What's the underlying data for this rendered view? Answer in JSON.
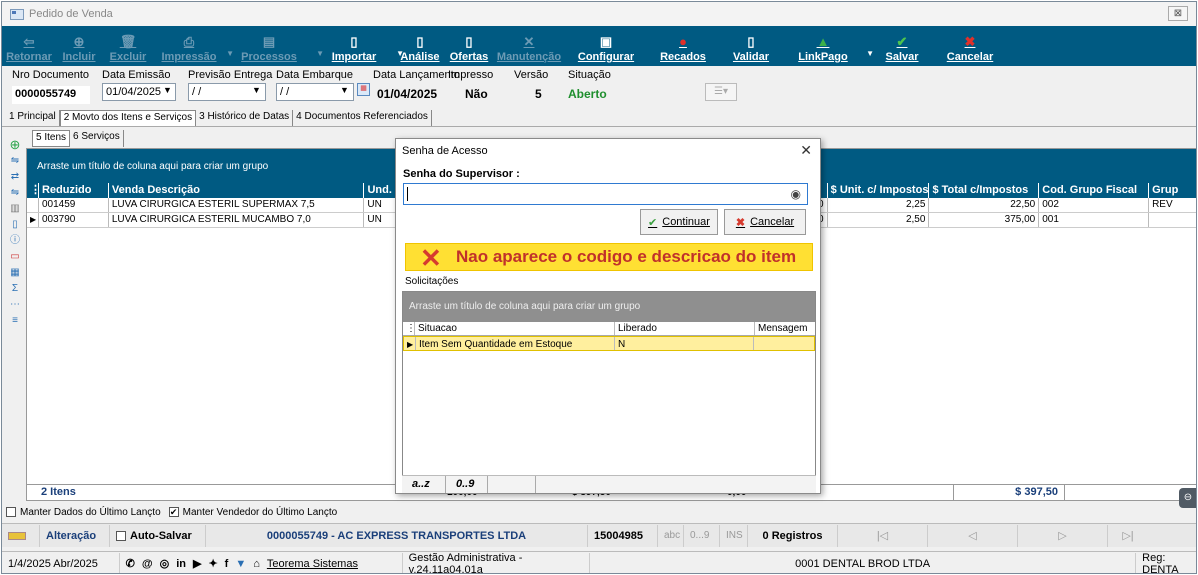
{
  "window": {
    "title": "Pedido de Venda",
    "close_label": "⊠"
  },
  "toolbar": {
    "buttons": [
      {
        "label": "Retornar",
        "icon": "⇦",
        "enabled": false
      },
      {
        "label": "Incluir",
        "icon": "⊕",
        "enabled": false
      },
      {
        "label": "Excluir",
        "icon": "🗑",
        "enabled": false
      },
      {
        "label": "Impressão",
        "icon": "⎙",
        "enabled": false
      },
      {
        "label": "Processos",
        "icon": "▤",
        "enabled": false
      },
      {
        "label": "Importar",
        "icon": "▯",
        "enabled": true
      },
      {
        "label": "Análise",
        "icon": "▯",
        "enabled": true
      },
      {
        "label": "Ofertas",
        "icon": "▯",
        "enabled": true
      },
      {
        "label": "Manutenção",
        "icon": "✕",
        "enabled": false
      },
      {
        "label": "Configurar",
        "icon": "▣",
        "enabled": true
      },
      {
        "label": "Recados",
        "icon": "●",
        "enabled": true
      },
      {
        "label": "Validar",
        "icon": "▯",
        "enabled": true
      },
      {
        "label": "LinkPago",
        "icon": "▲",
        "enabled": true
      },
      {
        "label": "Salvar",
        "icon": "✔",
        "enabled": true
      },
      {
        "label": "Cancelar",
        "icon": "✖",
        "enabled": true
      }
    ]
  },
  "form": {
    "nro_documento_label": "Nro Documento",
    "nro_documento": "0000055749",
    "data_emissao_label": "Data Emissão",
    "data_emissao": "01/04/2025",
    "previsao_entrega_label": "Previsão Entrega",
    "previsao_entrega": "/ /",
    "data_embarque_label": "Data Embarque",
    "data_embarque": "/ /",
    "data_lancamento_label": "Data Lançamento",
    "data_lancamento": "01/04/2025",
    "impresso_label": "Impresso",
    "impresso": "Não",
    "versao_label": "Versão",
    "versao": "5",
    "situacao_label": "Situação",
    "situacao": "Aberto"
  },
  "tabs": [
    "1 Principal",
    "2 Movto dos Itens e Serviços",
    "3 Histórico de Datas",
    "4 Documentos Referenciados"
  ],
  "subtabs": [
    "5 Itens",
    "6 Serviços"
  ],
  "grid": {
    "group_hint": "Arraste um título de coluna aqui para criar um grupo",
    "columns": [
      "Reduzido",
      "Venda Descrição",
      "Und.",
      "nto",
      "$ Unit. c/ Impostos",
      "$ Total c/Impostos",
      "Cod. Grupo Fiscal",
      "Grup"
    ],
    "rows": [
      {
        "reduzido": "001459",
        "descricao": "LUVA CIRURGICA ESTERIL SUPERMAX 7,5",
        "und": "UN",
        "desc": "0,00",
        "unit": "2,25",
        "total": "22,50",
        "grupo_fiscal": "002",
        "grupo": "REV"
      },
      {
        "reduzido": "003790",
        "descricao": "LUVA CIRURGICA ESTERIL MUCAMBO 7,0",
        "und": "UN",
        "desc": "0,00",
        "unit": "2,50",
        "total": "375,00",
        "grupo_fiscal": "001",
        "grupo": ""
      }
    ],
    "footer_count": "2 Itens",
    "footer_total": "$ 397,50",
    "footer_partial_1": "100,00",
    "footer_partial_2": "$ 397,50",
    "footer_partial_3": "0,00"
  },
  "checks": {
    "manter_dados": "Manter Dados do Último Lançto",
    "manter_vendedor": "Manter Vendedor do Último Lançto"
  },
  "statusbar": {
    "mode": "Alteração",
    "auto_salvar": "Auto-Salvar",
    "documento": "0000055749 - AC EXPRESS TRANSPORTES LTDA",
    "codigo": "15004985",
    "abc": "abc",
    "num": "0...9",
    "ins": "INS",
    "registros": "0 Registros"
  },
  "bottombar": {
    "date": "1/4/2025 Abr/2025",
    "company_link": "Teorema Sistemas",
    "version": "Gestão Administrativa - v.24.11a04.01a",
    "empresa": "0001 DENTAL BROD LTDA",
    "reg": "Reg: DENTA"
  },
  "dialog": {
    "title": "Senha de Acesso",
    "close": "✕",
    "password_label": "Senha do Supervisor :",
    "password_value": "",
    "continuar": "Continuar",
    "cancelar": "Cancelar",
    "note": "Nao aparece o codigo e descricao do item",
    "solicitacoes_label": "Solicitações",
    "group_hint": "Arraste um título de coluna aqui para criar um grupo",
    "columns": [
      "Situacao",
      "Liberado",
      "Mensagem"
    ],
    "rows": [
      {
        "situacao": "Item Sem Quantidade em Estoque",
        "liberado": "N",
        "mensagem": ""
      }
    ],
    "footer_az": "a..z",
    "footer_09": "0..9"
  },
  "colors": {
    "toolbar": "#005a82",
    "grid_header": "#005a82",
    "note_bg": "#ffe033",
    "note_text": "#c0312b",
    "situacao": "#1f8f2e"
  }
}
